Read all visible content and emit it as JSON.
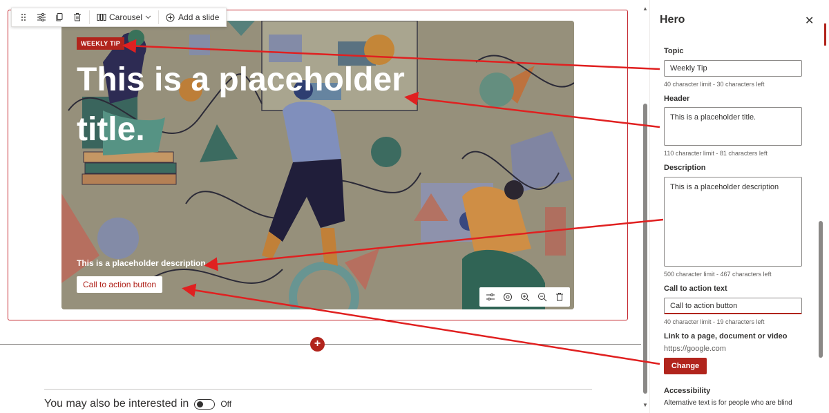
{
  "toolbar": {
    "layout_label": "Carousel",
    "add_slide_label": "Add a slide"
  },
  "hero": {
    "topic": "WEEKLY TIP",
    "title": "This is a placeholder title.",
    "description": "This is a placeholder description",
    "cta": "Call to action button"
  },
  "section": {
    "interested_label": "You may also be interested in",
    "toggle_state": "Off"
  },
  "panel": {
    "title": "Hero",
    "topic_label": "Topic",
    "topic_value": "Weekly Tip",
    "topic_helper": "40 character limit - 30 characters left",
    "header_label": "Header",
    "header_value": "This is a placeholder title.",
    "header_helper": "110 character limit - 81 characters left",
    "description_label": "Description",
    "description_value": "This is a placeholder description",
    "description_helper": "500 character limit - 467 characters left",
    "cta_label": "Call to action text",
    "cta_value": "Call to action button",
    "cta_helper": "40 character limit - 19 characters left",
    "link_label": "Link to a page, document or video",
    "link_value": "https://google.com",
    "change_label": "Change",
    "accessibility_label": "Accessibility",
    "accessibility_text": "Alternative text is for people who are blind"
  },
  "colors": {
    "accent": "#b1241c",
    "annotation": "#e02020"
  }
}
